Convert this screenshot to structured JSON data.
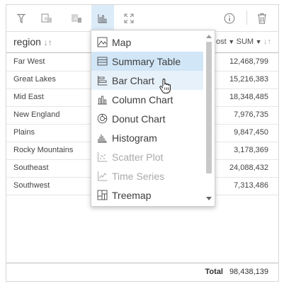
{
  "header": {
    "region_label": "region",
    "sort_icon": "sort-ascending-icon",
    "stat_label": "ost",
    "sum_label": "SUM"
  },
  "rows": [
    {
      "name": "Far West",
      "value": "12,468,799"
    },
    {
      "name": "Great Lakes",
      "value": "15,216,383"
    },
    {
      "name": "Mid East",
      "value": "18,348,485"
    },
    {
      "name": "New England",
      "value": "7,976,735"
    },
    {
      "name": "Plains",
      "value": "9,847,450"
    },
    {
      "name": "Rocky Mountains",
      "value": "3,178,369"
    },
    {
      "name": "Southeast",
      "value": "24,088,432"
    },
    {
      "name": "Southwest",
      "value": "7,313,486"
    }
  ],
  "footer": {
    "total_label": "Total",
    "total_value": "98,438,139"
  },
  "menu": {
    "items": [
      {
        "label": "Map",
        "icon": "map-icon",
        "state": "normal"
      },
      {
        "label": "Summary Table",
        "icon": "summary-table-icon",
        "state": "selected"
      },
      {
        "label": "Bar Chart",
        "icon": "bar-chart-icon",
        "state": "hover"
      },
      {
        "label": "Column Chart",
        "icon": "column-chart-icon",
        "state": "normal"
      },
      {
        "label": "Donut Chart",
        "icon": "donut-chart-icon",
        "state": "normal"
      },
      {
        "label": "Histogram",
        "icon": "histogram-icon",
        "state": "normal"
      },
      {
        "label": "Scatter Plot",
        "icon": "scatter-plot-icon",
        "state": "disabled"
      },
      {
        "label": "Time Series",
        "icon": "time-series-icon",
        "state": "disabled"
      },
      {
        "label": "Treemap",
        "icon": "treemap-icon",
        "state": "normal"
      }
    ]
  },
  "colors": {
    "accent": "#dcebf8",
    "selected": "#d1e6f7",
    "hover": "#e7f1fa",
    "text": "#4c4c4c"
  }
}
